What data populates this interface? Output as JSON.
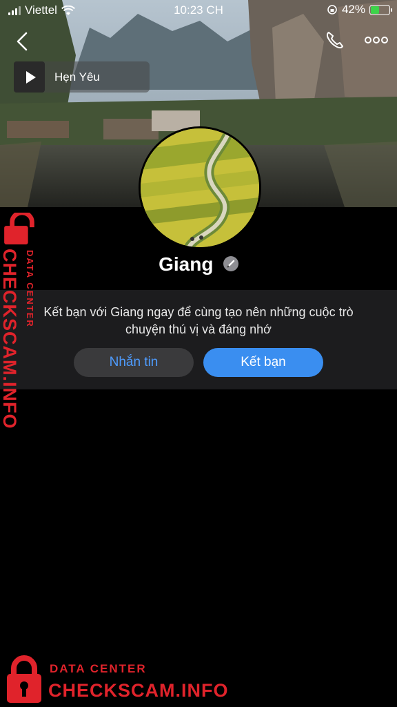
{
  "status_bar": {
    "carrier": "Viettel",
    "time": "10:23 CH",
    "battery": "42%",
    "battery_level": 0.42
  },
  "music": {
    "title": "Hẹn Yêu",
    "icon": "play-icon"
  },
  "profile": {
    "name": "Giang"
  },
  "invite": {
    "line1": "Kết bạn với Giang ngay để cùng tạo nên những cuộc trò",
    "line2": "chuyện thú vị và đáng nhớ"
  },
  "actions": {
    "message_label": "Nhắn tin",
    "add_friend_label": "Kết bạn"
  },
  "watermark": {
    "small": "DATA CENTER",
    "big": "CHECKSCAM.INFO"
  },
  "colors": {
    "accent": "#3a8ef0",
    "link": "#4e9cff",
    "watermark": "#e0232b",
    "panel": "#1c1c1e"
  }
}
